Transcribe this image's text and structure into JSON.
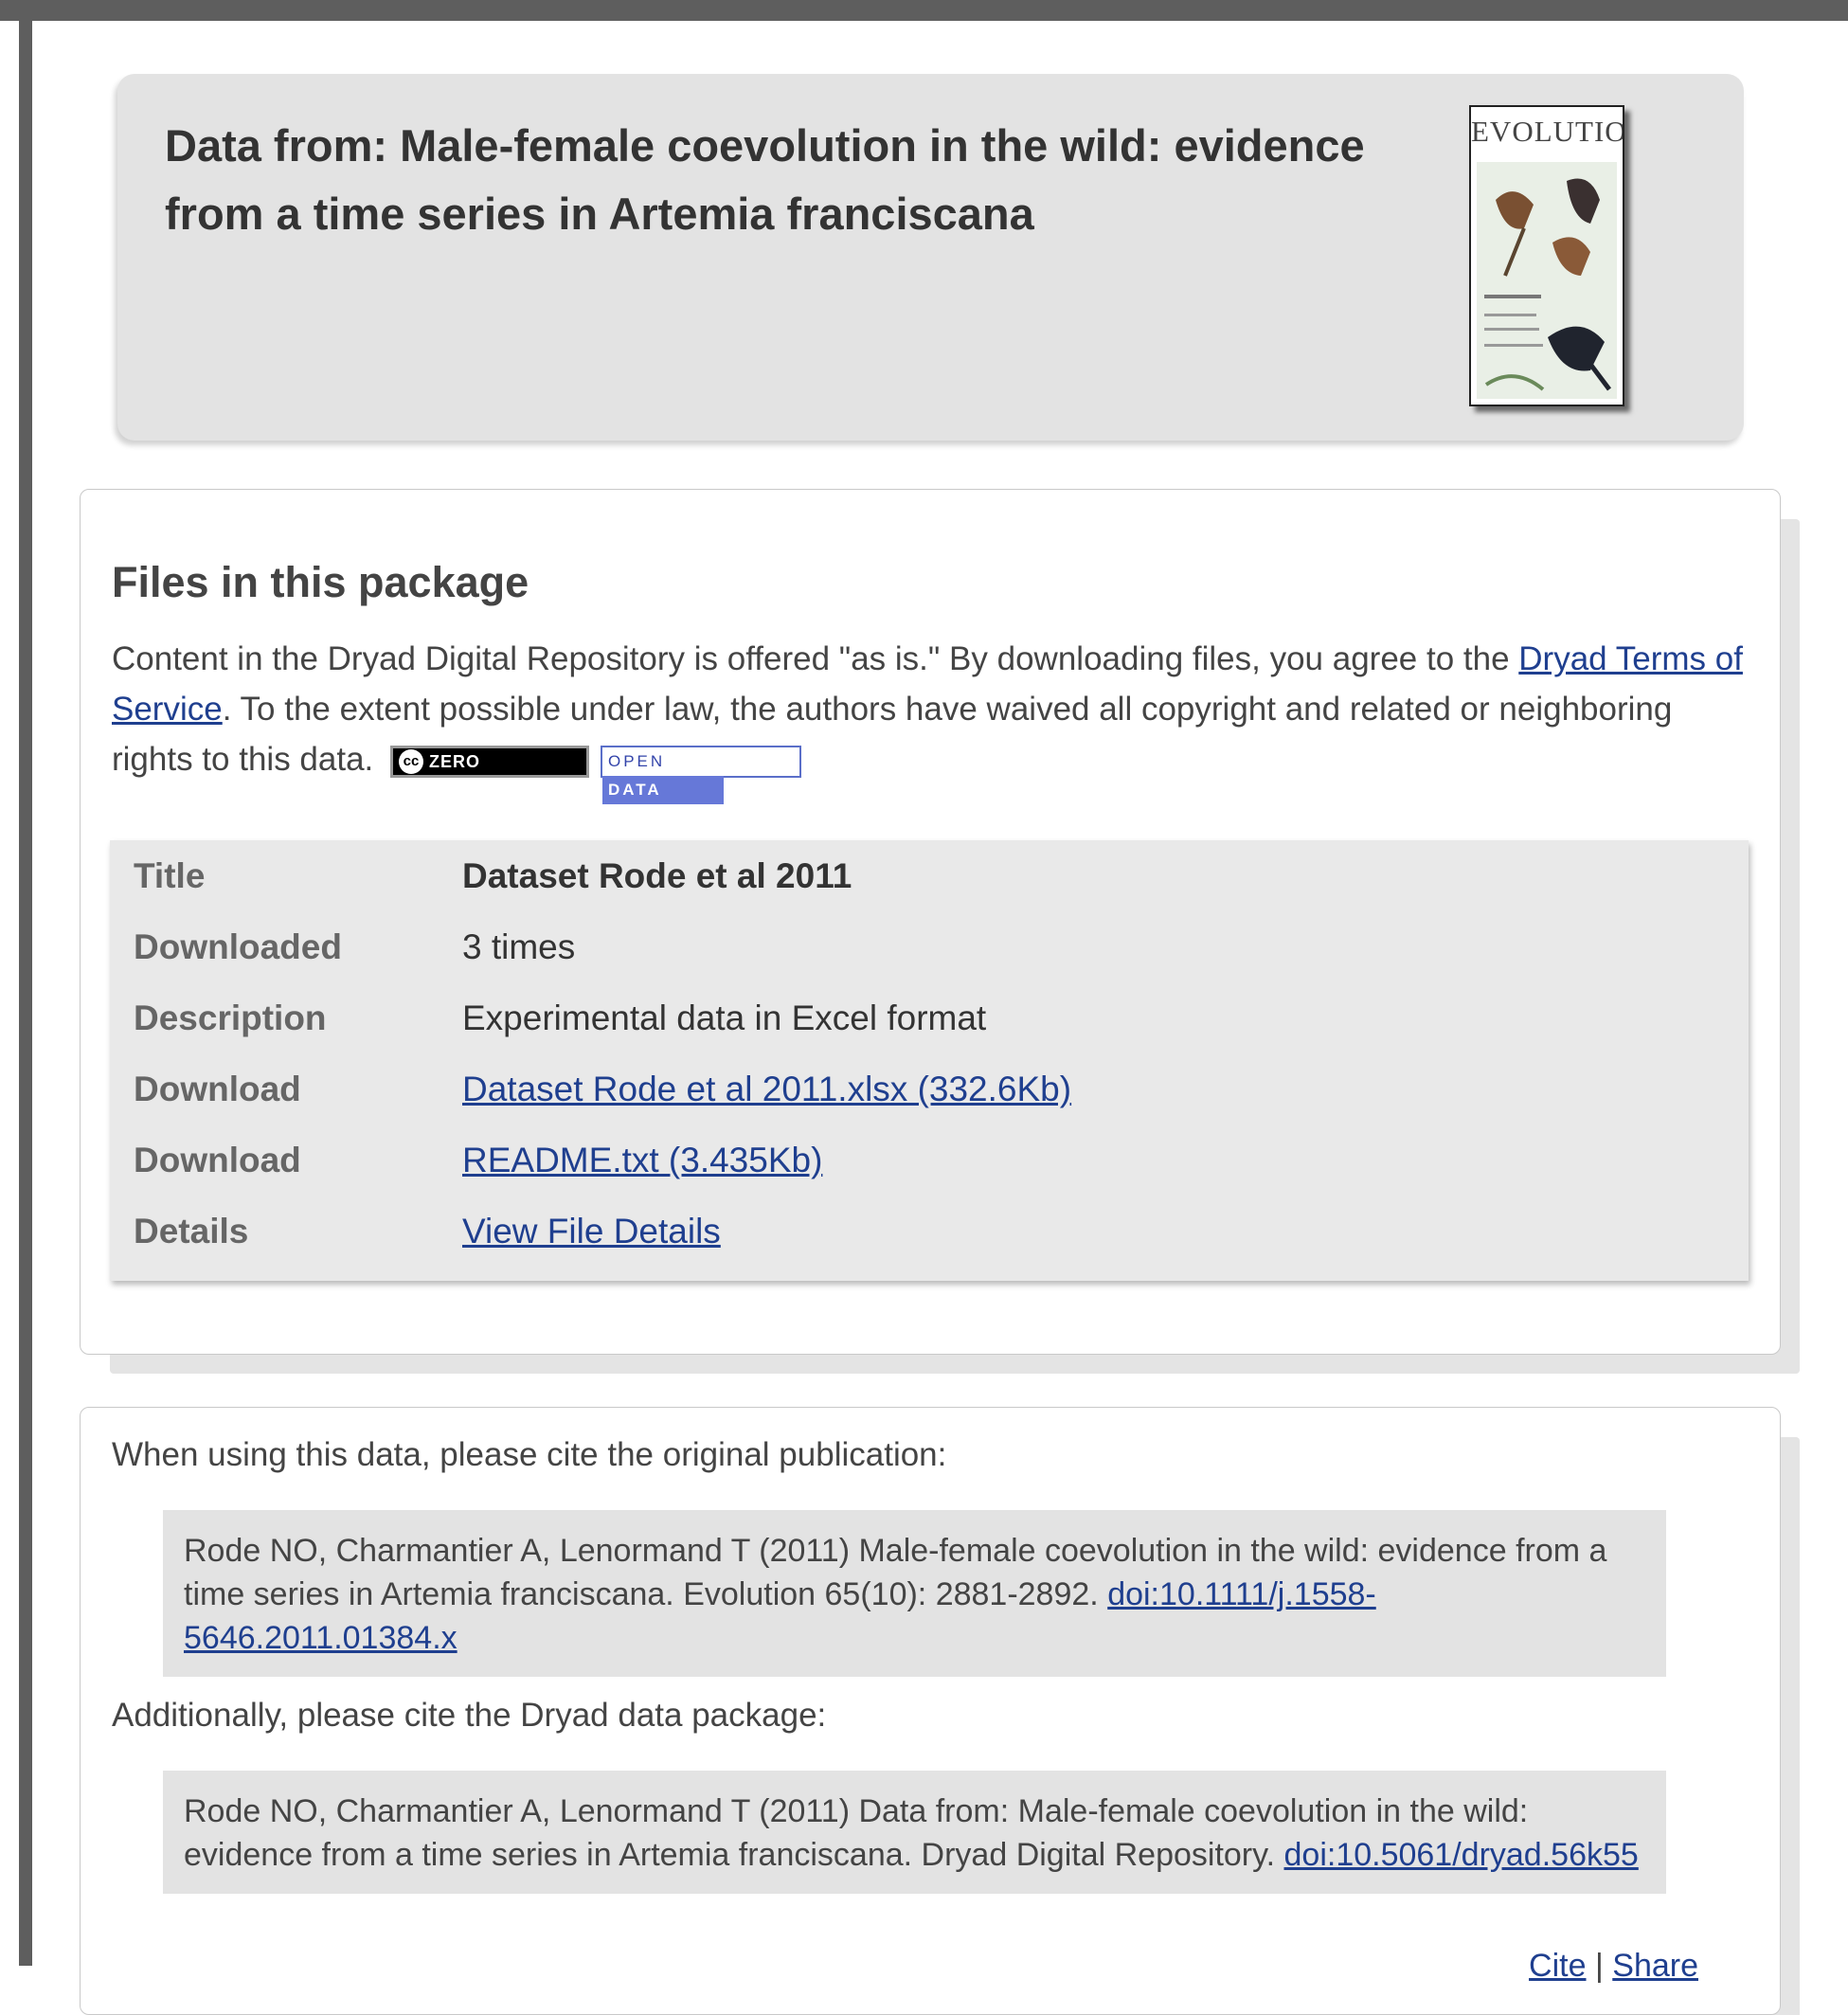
{
  "banner": {
    "title": "Data from: Male-female coevolution in the wild: evidence from a time series in Artemia franciscana",
    "cover": {
      "brand": "EVOLUTION"
    }
  },
  "files": {
    "heading": "Files in this package",
    "terms_pre": "Content in the Dryad Digital Repository is offered \"as is.\" By downloading files, you agree to the ",
    "terms_link": "Dryad Terms of Service",
    "terms_post": ". To the extent possible under law, the authors have waived all copyright and related or neighboring rights to this data.",
    "badge_cc": {
      "symbol": "cc",
      "text": "ZERO"
    },
    "badge_od": {
      "open": "OPEN",
      "data": "DATA"
    },
    "rows": [
      {
        "label": "Title",
        "value": "Dataset Rode et al 2011"
      },
      {
        "label": "Downloaded",
        "value": "3 times"
      },
      {
        "label": "Description",
        "value": "Experimental data in Excel format"
      },
      {
        "label": "Download",
        "value": "Dataset Rode et al 2011.xlsx (332.6Kb)"
      },
      {
        "label": "Download",
        "value": "README.txt (3.435Kb)"
      },
      {
        "label": "Details",
        "value": "View File Details"
      }
    ]
  },
  "cite": {
    "intro_publication": "When using this data, please cite the original publication:",
    "publication_text": "Rode NO, Charmantier A, Lenormand T (2011) Male-female coevolution in the wild: evidence from a time series in Artemia franciscana. Evolution 65(10): 2881-2892. ",
    "publication_doi": "doi:10.1111/j.1558-5646.2011.01384.x",
    "intro_package": "Additionally, please cite the Dryad data package:",
    "package_text": "Rode NO, Charmantier A, Lenormand T (2011) Data from: Male-female coevolution in the wild: evidence from a time series in Artemia franciscana. Dryad Digital Repository. ",
    "package_doi": "doi:10.5061/dryad.56k55",
    "cite_link": "Cite",
    "separator": "|",
    "share_link": "Share"
  }
}
